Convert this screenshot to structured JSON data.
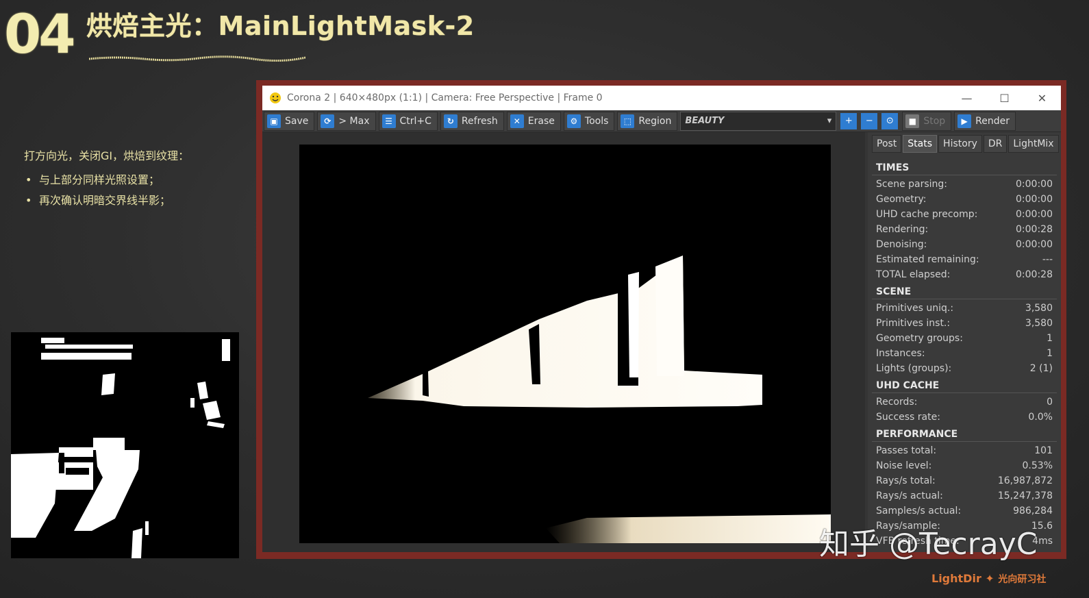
{
  "slide": {
    "number": "04",
    "title": "烘焙主光：MainLightMask-2",
    "intro": "打方向光，关闭GI，烘焙到纹理：",
    "bullets": [
      "与上部分同样光照设置；",
      "再次确认明暗交界线半影；"
    ],
    "bullet_symbol": "•"
  },
  "window": {
    "title": "Corona 2 | 640×480px (1:1) | Camera: Free Perspective | Frame 0",
    "controls": {
      "minimize": "—",
      "maximize": "☐",
      "close": "✕"
    }
  },
  "toolbar": {
    "save": "Save",
    "to_max": "> Max",
    "copy": "Ctrl+C",
    "refresh": "Refresh",
    "erase": "Erase",
    "tools": "Tools",
    "region": "Region",
    "channel": "BEAUTY",
    "stop": "Stop",
    "render": "Render"
  },
  "tabs": [
    "Post",
    "Stats",
    "History",
    "DR",
    "LightMix"
  ],
  "active_tab": "Stats",
  "stats": {
    "times": {
      "title": "TIMES",
      "rows": [
        {
          "label": "Scene parsing:",
          "value": "0:00:00"
        },
        {
          "label": "Geometry:",
          "value": "0:00:00"
        },
        {
          "label": "UHD cache precomp:",
          "value": "0:00:00"
        },
        {
          "label": "Rendering:",
          "value": "0:00:28"
        },
        {
          "label": "Denoising:",
          "value": "0:00:00"
        },
        {
          "label": "Estimated remaining:",
          "value": "---"
        },
        {
          "label": "TOTAL elapsed:",
          "value": "0:00:28"
        }
      ]
    },
    "scene": {
      "title": "SCENE",
      "rows": [
        {
          "label": "Primitives uniq.:",
          "value": "3,580"
        },
        {
          "label": "Primitives inst.:",
          "value": "3,580"
        },
        {
          "label": "Geometry groups:",
          "value": "1"
        },
        {
          "label": "Instances:",
          "value": "1"
        },
        {
          "label": "Lights (groups):",
          "value": "2 (1)"
        }
      ]
    },
    "uhd_cache": {
      "title": "UHD CACHE",
      "rows": [
        {
          "label": "Records:",
          "value": "0"
        },
        {
          "label": "Success rate:",
          "value": "0.0%"
        }
      ]
    },
    "performance": {
      "title": "PERFORMANCE",
      "rows": [
        {
          "label": "Passes total:",
          "value": "101"
        },
        {
          "label": "Noise level:",
          "value": "0.53%"
        },
        {
          "label": "Rays/s total:",
          "value": "16,987,872"
        },
        {
          "label": "Rays/s actual:",
          "value": "15,247,378"
        },
        {
          "label": "Samples/s actual:",
          "value": "986,284"
        },
        {
          "label": "Rays/sample:",
          "value": "15.6"
        },
        {
          "label": "VFB refresh time:",
          "value": "4ms"
        }
      ]
    }
  },
  "watermark": "知乎 @TecrayC",
  "logo": {
    "brand": "LightDir",
    "cn": "光向研习社"
  },
  "colors": {
    "accent_yellow": "#f1e7a8",
    "frame_red": "#7b2a24",
    "icon_blue": "#2f7dd1"
  }
}
